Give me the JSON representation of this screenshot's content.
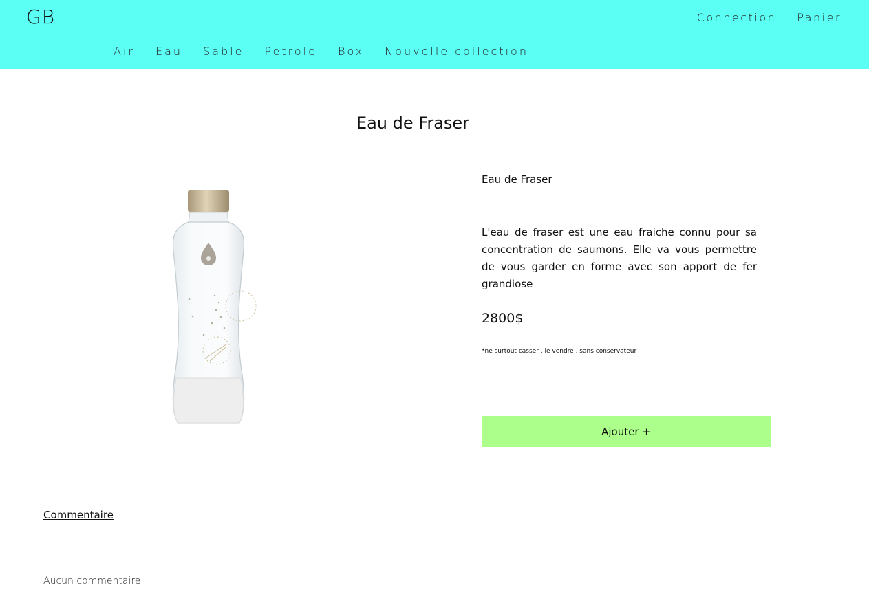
{
  "header": {
    "logo": "GB",
    "background_color": "#5cfff4",
    "user_nav": [
      "Connection",
      "Panier"
    ],
    "categories": [
      "Air",
      "Eau",
      "Sable",
      "Petrole",
      "Box",
      "Nouvelle collection"
    ]
  },
  "page": {
    "title": "Eau de Fraser"
  },
  "product": {
    "image_icon": "glass-water-bottle",
    "name": "Eau de Fraser",
    "description": "L'eau de fraser est une eau fraiche connu pour sa concentration de saumons. Elle va vous permettre de vous garder en forme avec son apport de fer grandiose",
    "price": "2800$",
    "note": "*ne surtout casser , le vendre , sans conservateur",
    "add_label": "Ajouter +",
    "add_button_color": "#acff8a"
  },
  "comments": {
    "title": "Commentaire",
    "empty_text": "Aucun commentaire"
  }
}
